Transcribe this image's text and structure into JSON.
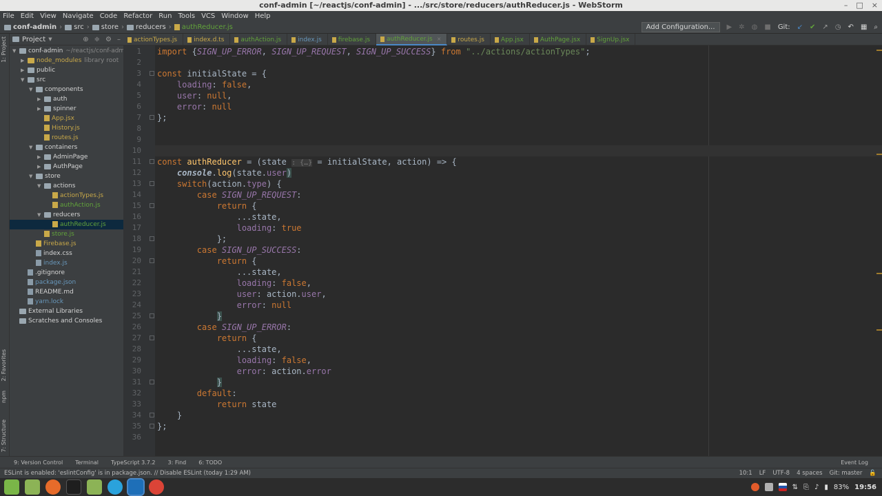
{
  "window": {
    "title": "conf-admin [~/reactjs/conf-admin] - .../src/store/reducers/authReducer.js - WebStorm",
    "controls": [
      "–",
      "□",
      "×"
    ]
  },
  "menu": [
    "File",
    "Edit",
    "View",
    "Navigate",
    "Code",
    "Refactor",
    "Run",
    "Tools",
    "VCS",
    "Window",
    "Help"
  ],
  "breadcrumbs": [
    "conf-admin",
    "src",
    "store",
    "reducers",
    "authReducer.js"
  ],
  "toolbar": {
    "add_config": "Add Configuration...",
    "git_label": "Git:"
  },
  "left_strip": {
    "project": "1: Project",
    "favorites": "2: Favorites",
    "npm": "npm",
    "structure": "7: Structure"
  },
  "project_panel": {
    "title": "Project",
    "items": [
      {
        "label": "conf-admin",
        "extra": "~/reactjs/conf-admin",
        "kind": "folder",
        "depth": 0,
        "open": true
      },
      {
        "label": "node_modules",
        "extra": "library root",
        "kind": "excluded",
        "depth": 1,
        "open": false
      },
      {
        "label": "public",
        "kind": "folder",
        "depth": 1,
        "open": false
      },
      {
        "label": "src",
        "kind": "folder",
        "depth": 1,
        "open": true
      },
      {
        "label": "components",
        "kind": "folder",
        "depth": 2,
        "open": true
      },
      {
        "label": "auth",
        "kind": "folder",
        "depth": 3,
        "open": false
      },
      {
        "label": "spinner",
        "kind": "folder",
        "depth": 3,
        "open": false
      },
      {
        "label": "App.jsx",
        "kind": "jsx",
        "depth": 3
      },
      {
        "label": "History.js",
        "kind": "jsx",
        "depth": 3
      },
      {
        "label": "routes.js",
        "kind": "jsx",
        "depth": 3
      },
      {
        "label": "containers",
        "kind": "folder",
        "depth": 2,
        "open": true
      },
      {
        "label": "AdminPage",
        "kind": "folder",
        "depth": 3,
        "open": false
      },
      {
        "label": "AuthPage",
        "kind": "folder",
        "depth": 3,
        "open": false
      },
      {
        "label": "store",
        "kind": "folder",
        "depth": 2,
        "open": true
      },
      {
        "label": "actions",
        "kind": "folder",
        "depth": 3,
        "open": true
      },
      {
        "label": "actionTypes.js",
        "kind": "js",
        "depth": 4
      },
      {
        "label": "authAction.js",
        "kind": "green",
        "depth": 4
      },
      {
        "label": "reducers",
        "kind": "folder",
        "depth": 3,
        "open": true
      },
      {
        "label": "authReducer.js",
        "kind": "green",
        "depth": 4,
        "selected": true
      },
      {
        "label": "store.js",
        "kind": "green",
        "depth": 3
      },
      {
        "label": "Firebase.js",
        "kind": "jsx",
        "depth": 2
      },
      {
        "label": "index.css",
        "kind": "css",
        "depth": 2
      },
      {
        "label": "index.js",
        "kind": "blue",
        "depth": 2
      },
      {
        "label": ".gitignore",
        "kind": "css",
        "depth": 1
      },
      {
        "label": "package.json",
        "kind": "blue",
        "depth": 1
      },
      {
        "label": "README.md",
        "kind": "css",
        "depth": 1
      },
      {
        "label": "yarn.lock",
        "kind": "blue",
        "depth": 1
      },
      {
        "label": "External Libraries",
        "kind": "folder",
        "depth": 0
      },
      {
        "label": "Scratches and Consoles",
        "kind": "folder",
        "depth": 0
      }
    ]
  },
  "tabs": [
    {
      "label": "actionTypes.js",
      "color": "#c9a949"
    },
    {
      "label": "index.d.ts",
      "color": "#c9a949"
    },
    {
      "label": "authAction.js",
      "color": "#62a33b"
    },
    {
      "label": "index.js",
      "color": "#6897bb"
    },
    {
      "label": "firebase.js",
      "color": "#62a33b"
    },
    {
      "label": "authReducer.js",
      "color": "#62a33b",
      "active": true
    },
    {
      "label": "routes.js",
      "color": "#c9a949"
    },
    {
      "label": "App.jsx",
      "color": "#62a33b"
    },
    {
      "label": "AuthPage.jsx",
      "color": "#62a33b"
    },
    {
      "label": "SignUp.jsx",
      "color": "#62a33b"
    }
  ],
  "editor": {
    "current_line": 10,
    "lines": [
      [
        [
          "kw",
          "import "
        ],
        [
          "p",
          "{"
        ],
        [
          "cnst",
          "SIGN_UP_ERROR"
        ],
        [
          "p",
          ", "
        ],
        [
          "cnst",
          "SIGN_UP_REQUEST"
        ],
        [
          "p",
          ", "
        ],
        [
          "cnst",
          "SIGN_UP_SUCCESS"
        ],
        [
          "p",
          "} "
        ],
        [
          "kw",
          "from "
        ],
        [
          "str",
          "\"../actions/actionTypes\""
        ],
        [
          "p",
          ";"
        ]
      ],
      [],
      [
        [
          "kw",
          "const "
        ],
        [
          "p",
          "initialState = {"
        ]
      ],
      [
        [
          "p",
          "    "
        ],
        [
          "prop",
          "loading"
        ],
        [
          "p",
          ": "
        ],
        [
          "kw",
          "false"
        ],
        [
          "p",
          ","
        ]
      ],
      [
        [
          "p",
          "    "
        ],
        [
          "prop",
          "user"
        ],
        [
          "p",
          ": "
        ],
        [
          "kw",
          "null"
        ],
        [
          "p",
          ","
        ]
      ],
      [
        [
          "p",
          "    "
        ],
        [
          "prop",
          "error"
        ],
        [
          "p",
          ": "
        ],
        [
          "kw",
          "null"
        ]
      ],
      [
        [
          "p",
          "};"
        ]
      ],
      [],
      [],
      [],
      [
        [
          "kw",
          "const "
        ],
        [
          "fn",
          "authReducer"
        ],
        [
          "p",
          " = (state "
        ],
        [
          "hint",
          ": {…}"
        ],
        [
          "p",
          " = initialState, action) => {"
        ]
      ],
      [
        [
          "p",
          "    "
        ],
        [
          "log",
          "console"
        ],
        [
          "p",
          "."
        ],
        [
          "fn",
          "log"
        ],
        [
          "p",
          "(state."
        ],
        [
          "prop",
          "user"
        ],
        [
          "bh",
          ")"
        ]
      ],
      [
        [
          "p",
          "    "
        ],
        [
          "kw",
          "switch"
        ],
        [
          "p",
          "(action."
        ],
        [
          "prop",
          "type"
        ],
        [
          "p",
          ") {"
        ]
      ],
      [
        [
          "p",
          "        "
        ],
        [
          "kw",
          "case "
        ],
        [
          "cnst",
          "SIGN_UP_REQUEST"
        ],
        [
          "p",
          ":"
        ]
      ],
      [
        [
          "p",
          "            "
        ],
        [
          "kw",
          "return "
        ],
        [
          "p",
          "{"
        ]
      ],
      [
        [
          "p",
          "                ...state,"
        ]
      ],
      [
        [
          "p",
          "                "
        ],
        [
          "prop",
          "loading"
        ],
        [
          "p",
          ": "
        ],
        [
          "kw",
          "true"
        ]
      ],
      [
        [
          "p",
          "            };"
        ]
      ],
      [
        [
          "p",
          "        "
        ],
        [
          "kw",
          "case "
        ],
        [
          "cnst",
          "SIGN_UP_SUCCESS"
        ],
        [
          "p",
          ":"
        ]
      ],
      [
        [
          "p",
          "            "
        ],
        [
          "kw",
          "return "
        ],
        [
          "p",
          "{"
        ]
      ],
      [
        [
          "p",
          "                ...state,"
        ]
      ],
      [
        [
          "p",
          "                "
        ],
        [
          "prop",
          "loading"
        ],
        [
          "p",
          ": "
        ],
        [
          "kw",
          "false"
        ],
        [
          "p",
          ","
        ]
      ],
      [
        [
          "p",
          "                "
        ],
        [
          "prop",
          "user"
        ],
        [
          "p",
          ": action."
        ],
        [
          "prop",
          "user"
        ],
        [
          "p",
          ","
        ]
      ],
      [
        [
          "p",
          "                "
        ],
        [
          "prop",
          "error"
        ],
        [
          "p",
          ": "
        ],
        [
          "kw",
          "null"
        ]
      ],
      [
        [
          "p",
          "            "
        ],
        [
          "bh",
          "}"
        ]
      ],
      [
        [
          "p",
          "        "
        ],
        [
          "kw",
          "case "
        ],
        [
          "cnst",
          "SIGN_UP_ERROR"
        ],
        [
          "p",
          ":"
        ]
      ],
      [
        [
          "p",
          "            "
        ],
        [
          "kw",
          "return "
        ],
        [
          "p",
          "{"
        ]
      ],
      [
        [
          "p",
          "                ...state,"
        ]
      ],
      [
        [
          "p",
          "                "
        ],
        [
          "prop",
          "loading"
        ],
        [
          "p",
          ": "
        ],
        [
          "kw",
          "false"
        ],
        [
          "p",
          ","
        ]
      ],
      [
        [
          "p",
          "                "
        ],
        [
          "prop",
          "error"
        ],
        [
          "p",
          ": action."
        ],
        [
          "prop",
          "error"
        ]
      ],
      [
        [
          "p",
          "            "
        ],
        [
          "bh",
          "}"
        ]
      ],
      [
        [
          "p",
          "        "
        ],
        [
          "kw",
          "default"
        ],
        [
          "p",
          ":"
        ]
      ],
      [
        [
          "p",
          "            "
        ],
        [
          "kw",
          "return "
        ],
        [
          "p",
          "state"
        ]
      ],
      [
        [
          "p",
          "    }"
        ]
      ],
      [
        [
          "p",
          "};"
        ]
      ],
      []
    ]
  },
  "bottom_tools": [
    "9: Version Control",
    "Terminal",
    "TypeScript 3.7.2",
    "3: Find",
    "6: TODO"
  ],
  "event_log": "Event Log",
  "status": {
    "message": "ESLint is enabled: 'eslintConfig' is in package.json. // Disable ESLint (today 1:29 AM)",
    "position": "10:1",
    "line_sep": "LF",
    "encoding": "UTF-8",
    "indent": "4 spaces",
    "git": "Git: master"
  },
  "os_tray": {
    "battery": "83%",
    "time": "19:56"
  },
  "colors": {
    "accent": "#4a88c7",
    "keyword": "#cc7832",
    "string": "#6a8759",
    "constant": "#9876aa",
    "function": "#ffc66d"
  }
}
